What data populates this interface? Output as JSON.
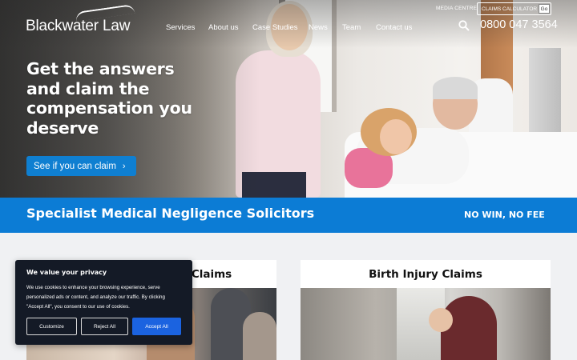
{
  "brand": {
    "name_main": "Blackwater",
    "name_law": "Law"
  },
  "header": {
    "media_centre": "MEDIA CENTRE",
    "claims_calculator": "CLAIMS CALCULATOR",
    "go_label": "Go",
    "phone": "0800 047 3564",
    "nav": [
      {
        "label": "Services"
      },
      {
        "label": "About us"
      },
      {
        "label": "Case Studies"
      },
      {
        "label": "News"
      },
      {
        "label": "Team"
      },
      {
        "label": "Contact us"
      }
    ]
  },
  "hero": {
    "headline": "Get the answers and claim the compensation you deserve",
    "cta_label": "See if you can claim"
  },
  "band": {
    "title": "Specialist Medical Negligence Solicitors",
    "tagline": "NO WIN, NO FEE"
  },
  "cards": [
    {
      "title": "Claims"
    },
    {
      "title": "Birth Injury Claims"
    }
  ],
  "cookie": {
    "title": "We value your privacy",
    "text": "We use cookies to enhance your browsing experience, serve personalized ads or content, and analyze our traffic. By clicking \"Accept All\", you consent to our use of cookies.",
    "customize": "Customize",
    "reject": "Reject All",
    "accept": "Accept All"
  },
  "colors": {
    "brand_blue": "#0c7cd5",
    "cta_blue": "#0f7fd1",
    "accept_blue": "#1b63e0",
    "cookie_bg": "#141a26"
  }
}
